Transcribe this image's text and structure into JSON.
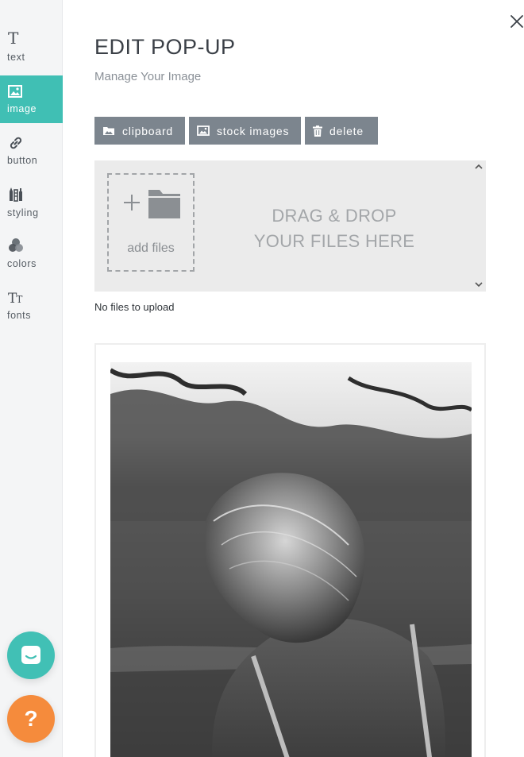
{
  "sidebar": {
    "items": [
      {
        "label": "text",
        "icon": "text-icon"
      },
      {
        "label": "image",
        "icon": "image-icon",
        "active": true
      },
      {
        "label": "button",
        "icon": "link-icon"
      },
      {
        "label": "styling",
        "icon": "paint-tools-icon"
      },
      {
        "label": "colors",
        "icon": "color-circles-icon"
      },
      {
        "label": "fonts",
        "icon": "font-size-icon"
      }
    ],
    "help_label": "?"
  },
  "header": {
    "title": "EDIT POP-UP",
    "subtitle": "Manage Your Image"
  },
  "toolbar": {
    "clipboard_label": "clipboard",
    "stock_images_label": "stock images",
    "delete_label": "delete"
  },
  "dropzone": {
    "add_files_label": "add files",
    "line1": "DRAG & DROP",
    "line2": "YOUR FILES HERE"
  },
  "status": "No files to upload",
  "colors": {
    "accent": "#40bfb4",
    "button": "#7c858e",
    "help": "#f58b3c",
    "chat": "#41c0b5"
  }
}
